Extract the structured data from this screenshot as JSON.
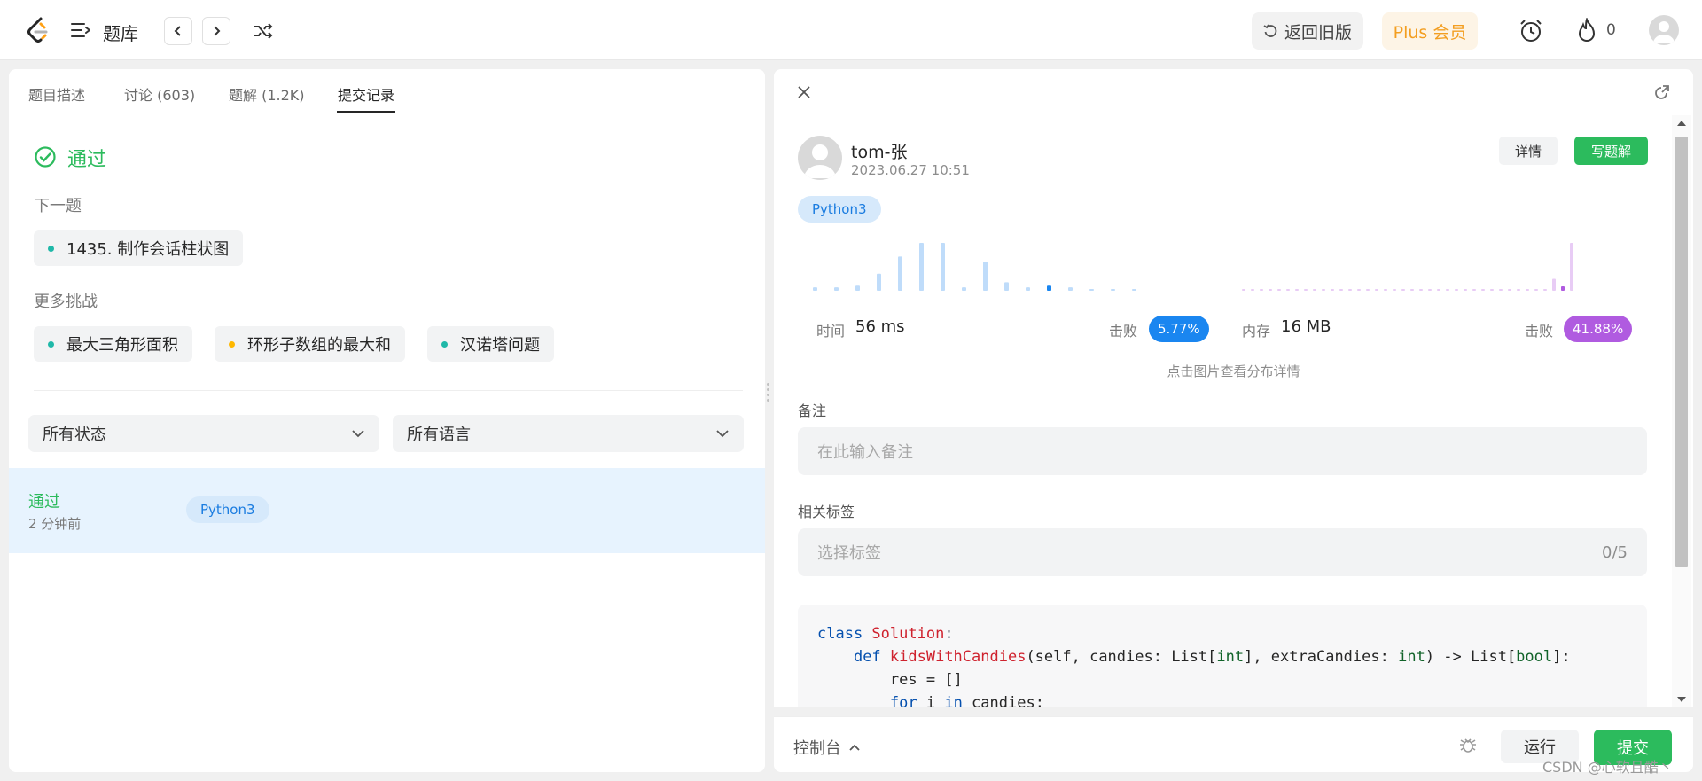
{
  "topbar": {
    "title": "题库",
    "old_version": "返回旧版",
    "plus": "Plus 会员",
    "fire_count": "0"
  },
  "tabs": [
    {
      "label": "题目描述"
    },
    {
      "label": "讨论 (603)"
    },
    {
      "label": "题解 (1.2K)"
    },
    {
      "label": "提交记录"
    }
  ],
  "result": {
    "status": "通过",
    "next_label": "下一题",
    "next_problem": "1435. 制作会话柱状图",
    "more_label": "更多挑战",
    "challenges": [
      "最大三角形面积",
      "环形子数组的最大和",
      "汉诺塔问题"
    ]
  },
  "filters": {
    "status": "所有状态",
    "language": "所有语言"
  },
  "submission": {
    "status": "通过",
    "time": "2 分钟前",
    "language": "Python3"
  },
  "detail": {
    "user": "tom-张",
    "date": "2023.06.27 10:51",
    "detail_btn": "详情",
    "write_btn": "写题解",
    "language": "Python3",
    "time_label": "时间",
    "time_value": "56 ms",
    "beat_label": "击败",
    "time_beat": "5.77%",
    "mem_label": "内存",
    "mem_value": "16 MB",
    "mem_beat": "41.88%",
    "hint": "点击图片查看分布详情",
    "note_label": "备注",
    "note_placeholder": "在此输入备注",
    "tag_label": "相关标签",
    "tag_placeholder": "选择标签",
    "tag_count": "0/5"
  },
  "code": {
    "l1a": "class ",
    "l1b": "Solution",
    "l1c": ":",
    "l2a": "def ",
    "l2b": "kidsWithCandies",
    "l2c": "(self, candies: List[",
    "l2d": "int",
    "l2e": "], extraCandies: ",
    "l2f": "int",
    "l2g": ") -> List[",
    "l2h": "bool",
    "l2i": "]:",
    "l3": "res = []",
    "l4a": "for ",
    "l4b": "i ",
    "l4c": "in ",
    "l4d": "candies:"
  },
  "console": {
    "label": "控制台",
    "run": "运行",
    "submit": "提交"
  },
  "watermark": "CSDN @心软且酷丶",
  "histograms": {
    "time": [
      2,
      2,
      3,
      10,
      20,
      28,
      28,
      2,
      17,
      5,
      2,
      3,
      2,
      1,
      1,
      1
    ],
    "memory": [
      1,
      1,
      1,
      1,
      1,
      1,
      1,
      1,
      1,
      1,
      1,
      1,
      1,
      1,
      1,
      1,
      1,
      1,
      1,
      1,
      1,
      1,
      1,
      1,
      1,
      1,
      1,
      1,
      1,
      1,
      1,
      1,
      1,
      1,
      1,
      8,
      3,
      32
    ]
  },
  "colors": {
    "green": "#2cbb5d",
    "blue_badge": "#1a86f0",
    "purple_badge": "#b05be0",
    "time_bar": "#bfdcfa",
    "time_bar_active": "#1a86f0",
    "mem_bar": "#e8ccf5",
    "mem_bar_active": "#b05be0"
  }
}
